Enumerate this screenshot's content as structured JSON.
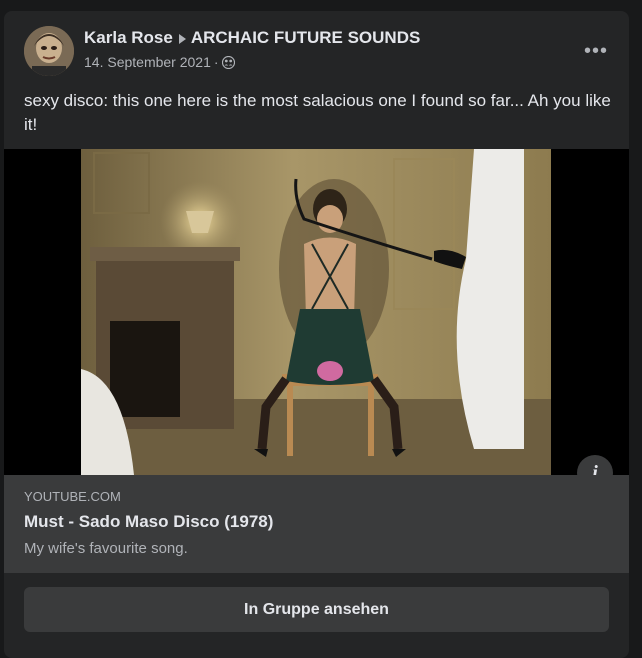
{
  "post": {
    "author": "Karla Rose",
    "group": "ARCHAIC FUTURE SOUNDS",
    "date": "14. September 2021",
    "separator": "·",
    "more_label": "•••",
    "text": "sexy disco: this one here is the most salacious one I found so far... Ah you like it!"
  },
  "link_preview": {
    "domain": "YOUTUBE.COM",
    "title": "Must - Sado Maso Disco (1978)",
    "description": "My wife's favourite song.",
    "info_label": "i"
  },
  "actions": {
    "view_in_group_label": "In Gruppe ansehen"
  },
  "icons": {
    "author_group_separator": "caret-right-icon",
    "privacy": "members-icon",
    "menu": "more-options-icon",
    "info": "info-icon"
  },
  "colors": {
    "background": "#18191a",
    "card": "#242526",
    "surface": "#3a3b3c",
    "text_primary": "#e4e6eb",
    "text_secondary": "#b0b3b8"
  }
}
